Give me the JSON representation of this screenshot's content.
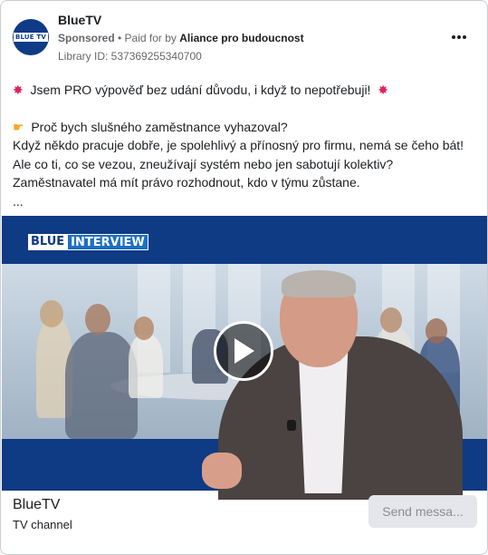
{
  "header": {
    "page_name": "BlueTV",
    "avatar_logo_text": "BLUE TV",
    "sponsored": "Sponsored",
    "separator": " • ",
    "paid_for_by": "Paid for by ",
    "advertiser": "Aliance pro budoucnost",
    "library_id": "Library ID: 537369255340700"
  },
  "post": {
    "line1": "Jsem PRO výpověď bez udání důvodu, i když to nepotřebuji!",
    "line2": "Proč bych slušného zaměstnance vyhazoval?",
    "line3": "Když někdo pracuje dobře, je spolehlivý a přínosný pro firmu, nemá se čeho bát!",
    "line4": "Ale co ti, co se vezou, zneužívají systém nebo jen sabotují kolektiv? Zaměstnavatel má mít právo rozhodnout, kdo v týmu zůstane.",
    "ellipsis": "..."
  },
  "media": {
    "banner_blue": "BLUE",
    "banner_interview": "INTERVIEW"
  },
  "footer": {
    "name": "BlueTV",
    "category": "TV channel",
    "cta_label": "Send messa..."
  },
  "colors": {
    "brand_blue": "#0f3a84",
    "text_primary": "#1c1e21",
    "text_secondary": "#65676b"
  },
  "icons": {
    "burst": "collision-emoji",
    "hand": "pointing-hand-emoji",
    "play": "play-icon",
    "more": "more-options-icon"
  }
}
